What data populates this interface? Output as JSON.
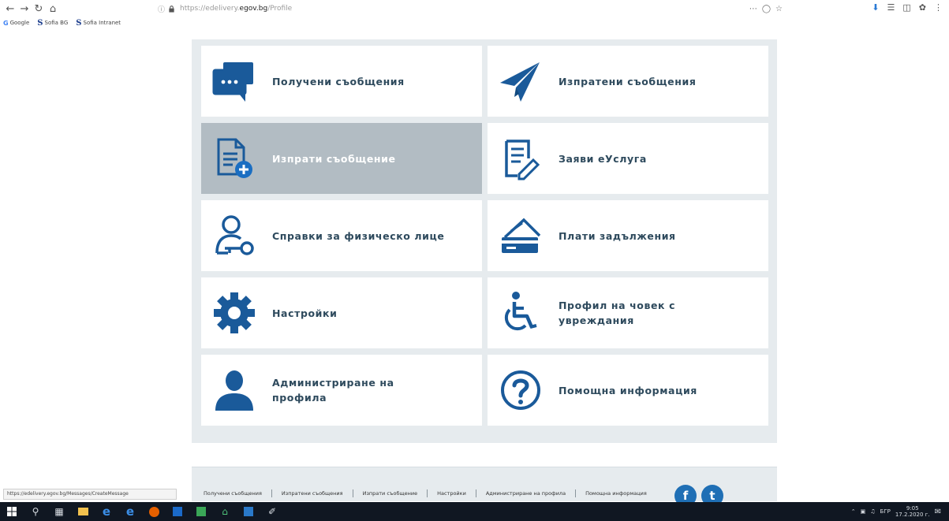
{
  "browser": {
    "url_prefix": "https://edelivery.",
    "url_host": "egov.bg",
    "url_path": "/Profile",
    "bookmarks": [
      {
        "label": "Google"
      },
      {
        "label": "Sofia BG"
      },
      {
        "label": "Sofia Intranet"
      }
    ],
    "status_url": "https://edelivery.egov.bg/Messages/CreateMessage"
  },
  "tiles": [
    {
      "label": "Получени съобщения",
      "icon": "chat-bubble-icon"
    },
    {
      "label": "Изпратени съобщения",
      "icon": "paper-plane-icon"
    },
    {
      "label": "Изпрати съобщение",
      "icon": "document-add-icon"
    },
    {
      "label": "Заяви еУслуга",
      "icon": "document-edit-icon"
    },
    {
      "label": "Справки за физическо лице",
      "icon": "user-key-icon"
    },
    {
      "label": "Плати задължения",
      "icon": "card-payment-icon"
    },
    {
      "label": "Настройки",
      "icon": "gear-icon"
    },
    {
      "label": "Профил на човек с увреждания",
      "icon": "wheelchair-icon"
    },
    {
      "label": "Администриране на профила",
      "icon": "user-silhouette-icon"
    },
    {
      "label": "Помощна информация",
      "icon": "question-circle-icon"
    }
  ],
  "footer": {
    "links": [
      "Получени съобщения",
      "Изпратени съобщения",
      "Изпрати съобщение",
      "Настройки",
      "Администриране на профила",
      "Помощна информация"
    ],
    "social": [
      "f",
      "t"
    ]
  },
  "taskbar": {
    "lang": "БГР",
    "time": "9:05",
    "date": "17.2.2020 г."
  },
  "colors": {
    "icon_blue": "#1a5a9a",
    "label_text": "#2e4a5d",
    "active_tile": "#b2bcc3",
    "page_bg": "#e6ebee"
  }
}
